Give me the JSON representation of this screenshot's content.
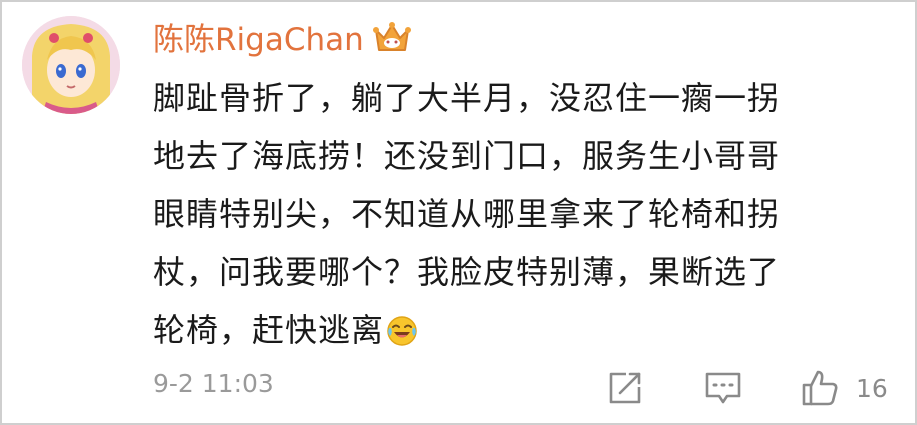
{
  "comment": {
    "username": "陈陈RigaChan",
    "badge_icon": "crown-badge-icon",
    "lines": [
      "脚趾骨折了，躺了大半月，没忍住一瘸一拐",
      "地去了海底捞！还没到门口，服务生小哥哥",
      "眼睛特别尖，不知道从哪里拿来了轮椅和拐",
      "杖，问我要哪个？我脸皮特别薄，果断选了",
      "轮椅，赶快逃离"
    ],
    "trailing_emoji": "laughing-crying-emoji",
    "timestamp": "9-2 11:03",
    "like_count": "16",
    "colors": {
      "username": "#e2733d",
      "text": "#1a1a1a",
      "meta": "#9a9a9a",
      "crown": "#f2a33a"
    }
  }
}
